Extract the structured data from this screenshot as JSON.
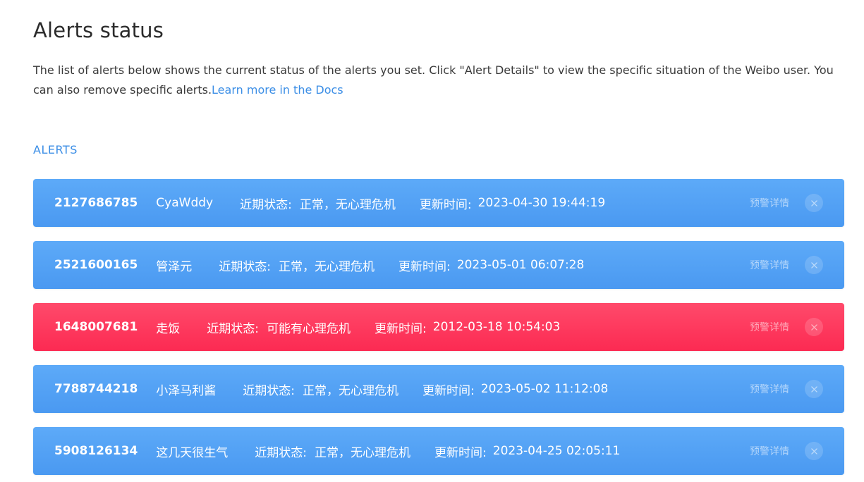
{
  "header": {
    "title": "Alerts status",
    "description": "The list of alerts below shows the current status of the alerts you set. Click \"Alert Details\" to view the specific situation of the Weibo user. You can also remove specific alerts.",
    "docs_link": "Learn more in the Docs"
  },
  "alerts_section": {
    "label": "ALERTS",
    "status_label": "近期状态:",
    "time_label": "更新时间:",
    "detail_label": "预警详情",
    "items": [
      {
        "uid": "2127686785",
        "name": "CyaWddy",
        "status": "正常，无心理危机",
        "updated": "2023-04-30 19:44:19",
        "level": "normal"
      },
      {
        "uid": "2521600165",
        "name": "管泽元",
        "status": "正常，无心理危机",
        "updated": "2023-05-01 06:07:28",
        "level": "normal"
      },
      {
        "uid": "1648007681",
        "name": "走饭",
        "status": "可能有心理危机",
        "updated": "2012-03-18 10:54:03",
        "level": "danger"
      },
      {
        "uid": "7788744218",
        "name": "小泽马利酱",
        "status": "正常，无心理危机",
        "updated": "2023-05-02 11:12:08",
        "level": "normal"
      },
      {
        "uid": "5908126134",
        "name": "这几天很生气",
        "status": "正常，无心理危机",
        "updated": "2023-04-25 02:05:11",
        "level": "normal"
      }
    ]
  },
  "colors": {
    "normal": "#4a99f1",
    "danger": "#fc2a52",
    "link": "#3b8ee6"
  },
  "icons": {
    "close": "close-icon"
  }
}
